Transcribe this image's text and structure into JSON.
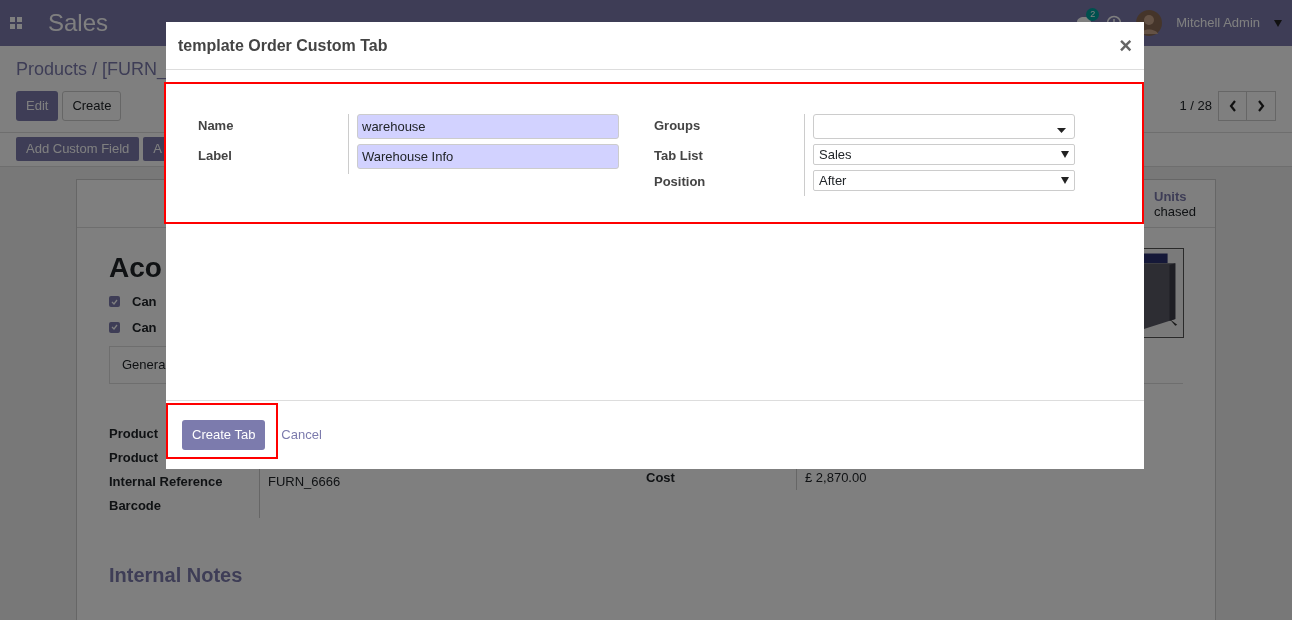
{
  "navbar": {
    "app": "Sales",
    "chat_badge": "2",
    "user": "Mitchell Admin"
  },
  "breadcrumb": "Products / [FURN_",
  "buttons": {
    "edit": "Edit",
    "create": "Create"
  },
  "pager": "1 / 28",
  "actions": [
    "Add Custom Field",
    "A"
  ],
  "stat": {
    "value": "Units",
    "label": "chased"
  },
  "product": {
    "title": "Aco",
    "checkboxes": [
      {
        "label": "Can",
        "checked": true
      },
      {
        "label": "Can",
        "checked": true
      }
    ],
    "tab": "Genera",
    "fields_left": [
      {
        "label": "Product"
      },
      {
        "label": "Product"
      },
      {
        "label": "Internal Reference",
        "value": "FURN_6666"
      },
      {
        "label": "Barcode"
      }
    ],
    "fields_right": [
      {
        "label": "Cost",
        "value": "£ 2,870.00"
      }
    ],
    "notes_heading": "Internal Notes"
  },
  "dialog": {
    "title": "template Order Custom Tab",
    "close": "×",
    "left_fields": [
      {
        "label": "Name",
        "value": "warehouse"
      },
      {
        "label": "Label",
        "value": "Warehouse Info"
      }
    ],
    "right_fields": [
      {
        "label": "Groups",
        "kind": "tags"
      },
      {
        "label": "Tab List",
        "value": "Sales",
        "kind": "select"
      },
      {
        "label": "Position",
        "value": "After",
        "kind": "select"
      }
    ],
    "primary_button": "Create Tab",
    "cancel": "Cancel"
  }
}
